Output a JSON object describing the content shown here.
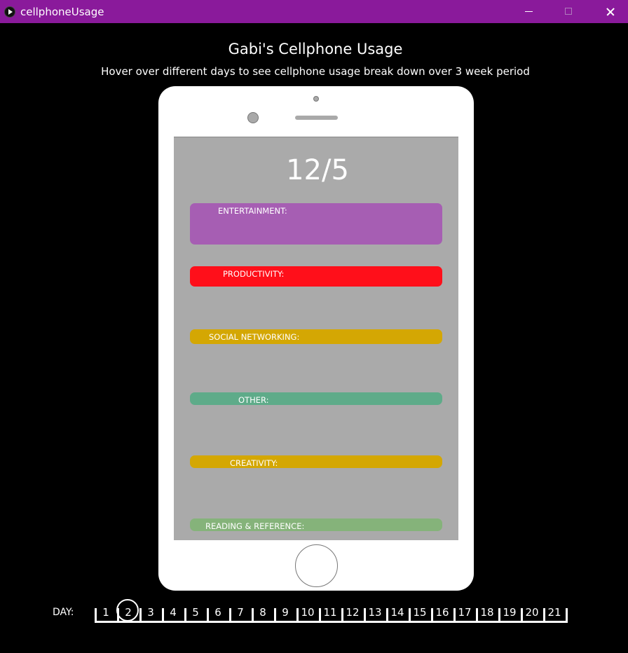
{
  "window": {
    "title": "cellphoneUsage"
  },
  "header": {
    "title": "Gabi's Cellphone Usage",
    "subtitle": "Hover over different days to see cellphone usage break down over 3 week period"
  },
  "phone": {
    "date": "12/5",
    "categories": [
      {
        "label": "ENTERTAINMENT:",
        "color": "#a65eb3"
      },
      {
        "label": "PRODUCTIVITY:",
        "color": "#ff0f1a"
      },
      {
        "label": "SOCIAL NETWORKING:",
        "color": "#d4a703"
      },
      {
        "label": "OTHER:",
        "color": "#5eab89"
      },
      {
        "label": "CREATIVITY:",
        "color": "#d4a703"
      },
      {
        "label": "READING & REFERENCE:",
        "color": "#85b37a"
      }
    ]
  },
  "day_selector": {
    "label": "DAY:",
    "days": [
      "1",
      "2",
      "3",
      "4",
      "5",
      "6",
      "7",
      "8",
      "9",
      "10",
      "11",
      "12",
      "13",
      "14",
      "15",
      "16",
      "17",
      "18",
      "19",
      "20",
      "21"
    ],
    "selected": "2"
  }
}
